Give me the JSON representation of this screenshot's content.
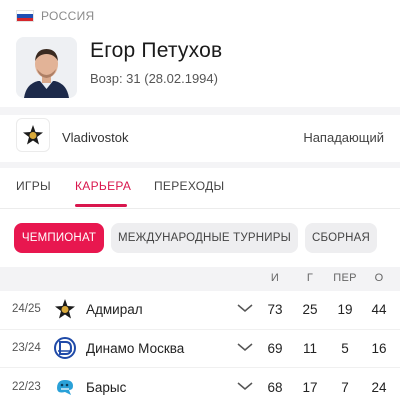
{
  "header": {
    "country": "РОССИЯ",
    "country_flag_colors": [
      "#ffffff",
      "#1f4fb4",
      "#d5262b"
    ],
    "player_name": "Егор Петухов",
    "age_line": "Возр: 31 (28.02.1994)"
  },
  "team": {
    "name": "Vladivostok",
    "position": "Нападающий"
  },
  "tabs": [
    {
      "label": "ИГРЫ"
    },
    {
      "label": "КАРЬЕРА"
    },
    {
      "label": "ПЕРЕХОДЫ"
    }
  ],
  "pills": [
    {
      "label": "ЧЕМПИОНАТ"
    },
    {
      "label": "МЕЖДУНАРОДНЫЕ ТУРНИРЫ"
    },
    {
      "label": "СБОРНАЯ"
    }
  ],
  "table": {
    "columns": [
      "И",
      "Г",
      "ПЕР",
      "О"
    ],
    "rows": [
      {
        "season": "24/25",
        "club": "Адмирал",
        "club_icon": "admiral-logo-icon",
        "games": "73",
        "goals": "25",
        "assists": "19",
        "points": "44"
      },
      {
        "season": "23/24",
        "club": "Динамо Москва",
        "club_icon": "dynamo-logo-icon",
        "games": "69",
        "goals": "11",
        "assists": "5",
        "points": "16"
      },
      {
        "season": "22/23",
        "club": "Барыс",
        "club_icon": "barys-logo-icon",
        "games": "68",
        "goals": "17",
        "assists": "7",
        "points": "24"
      }
    ]
  },
  "colors": {
    "accent": "#e8174f",
    "tab_accent": "#d9164d"
  }
}
